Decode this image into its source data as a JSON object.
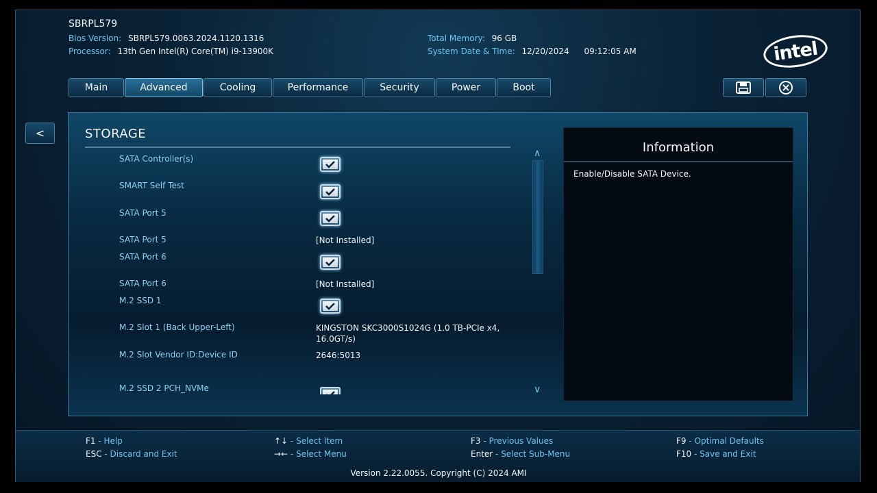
{
  "header": {
    "model": "SBRPL579",
    "bios_version_label": "Bios Version:",
    "bios_version": "SBRPL579.0063.2024.1120.1316",
    "processor_label": "Processor:",
    "processor": "13th Gen Intel(R) Core(TM) i9-13900K",
    "total_memory_label": "Total Memory:",
    "total_memory": "96 GB",
    "datetime_label": "System Date & Time:",
    "date": "12/20/2024",
    "time": "09:12:05 AM",
    "logo_text": "intel"
  },
  "tabs": [
    {
      "label": "Main"
    },
    {
      "label": "Advanced",
      "active": true
    },
    {
      "label": "Cooling"
    },
    {
      "label": "Performance"
    },
    {
      "label": "Security"
    },
    {
      "label": "Power"
    },
    {
      "label": "Boot"
    }
  ],
  "toolbar": {
    "save_icon": "floppy-disk-icon",
    "exit_icon": "close-circle-icon"
  },
  "back_label": "<",
  "section": {
    "title": "STORAGE",
    "rows": [
      {
        "label": "SATA Controller(s)",
        "type": "checkbox",
        "checked": true
      },
      {
        "label": "SMART Self Test",
        "type": "checkbox",
        "checked": true
      },
      {
        "label": "SATA Port 5",
        "type": "checkbox",
        "checked": true
      },
      {
        "label": "SATA Port 5",
        "type": "text",
        "value": "[Not Installed]"
      },
      {
        "label": "SATA Port 6",
        "type": "checkbox",
        "checked": true
      },
      {
        "label": "SATA Port 6",
        "type": "text",
        "value": "[Not Installed]"
      },
      {
        "label": "M.2 SSD 1",
        "type": "checkbox",
        "checked": true
      },
      {
        "label": "M.2 Slot 1 (Back Upper-Left)",
        "type": "text",
        "value": "KINGSTON SKC3000S1024G (1.0 TB-PCIe x4, 16.0GT/s)"
      },
      {
        "label": "M.2 Slot Vendor ID:Device ID",
        "type": "text",
        "value": "2646:5013"
      },
      {
        "label": "M.2 SSD 2 PCH_NVMe",
        "type": "checkbox",
        "checked": true
      }
    ]
  },
  "info": {
    "title": "Information",
    "text": "Enable/Disable SATA Device."
  },
  "footer": {
    "keys": [
      {
        "key": "F1",
        "action": "Help"
      },
      {
        "key": "ESC",
        "action": "Discard and Exit"
      },
      {
        "key": "↑↓",
        "action": "Select Item"
      },
      {
        "key": "→←",
        "action": "Select Menu"
      },
      {
        "key": "F3",
        "action": "Previous Values"
      },
      {
        "key": "Enter",
        "action": "Select Sub-Menu"
      },
      {
        "key": "F9",
        "action": "Optimal Defaults"
      },
      {
        "key": "F10",
        "action": "Save and Exit"
      }
    ],
    "copyright": "Version 2.22.0055. Copyright (C) 2024 AMI"
  }
}
